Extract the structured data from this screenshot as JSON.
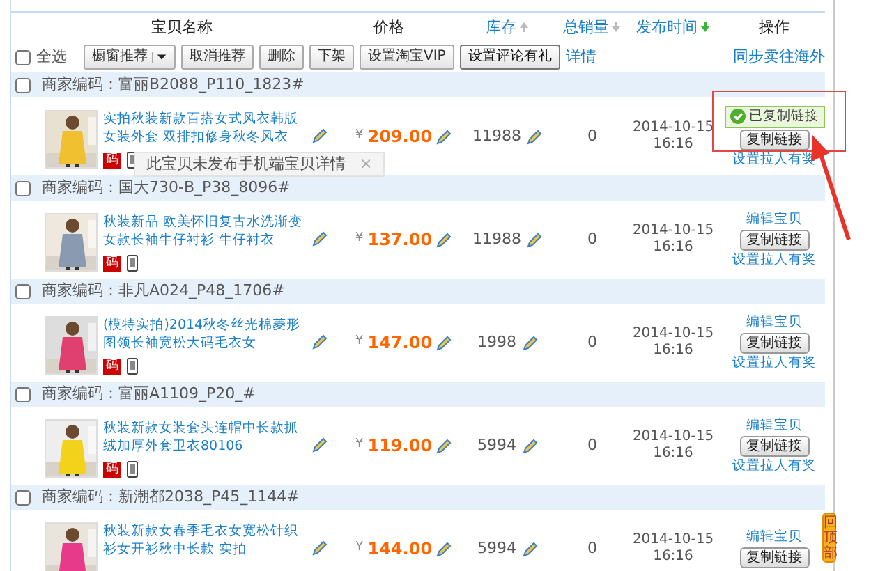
{
  "columns": [
    {
      "label": "宝贝名称",
      "kind": "plain"
    },
    {
      "label": "价格",
      "kind": "plain"
    },
    {
      "label": "库存",
      "kind": "sort",
      "ascending": true,
      "active": false
    },
    {
      "label": "总销量",
      "kind": "sort",
      "ascending": false,
      "active": false
    },
    {
      "label": "发布时间",
      "kind": "sort",
      "ascending": false,
      "active": true
    },
    {
      "label": "操作",
      "kind": "plain"
    }
  ],
  "toolbar": {
    "select_all": {
      "label": "全选",
      "checked": false
    },
    "buttons": [
      {
        "label": "橱窗推荐",
        "kind": "split"
      },
      {
        "label": "取消推荐",
        "kind": "button"
      },
      {
        "label": "删除",
        "kind": "button"
      },
      {
        "label": "下架",
        "kind": "button"
      },
      {
        "label": "设置淘宝VIP",
        "kind": "button"
      },
      {
        "label": "设置评论有礼",
        "kind": "strong"
      },
      {
        "label": "详情",
        "kind": "link"
      }
    ],
    "right_link": "同步卖往海外"
  },
  "groups": [
    {
      "code_label": "商家编码：",
      "code": "富丽B2088_P110_1823#",
      "checked": false,
      "highlighted": true,
      "tooltip": {
        "text": "此宝贝未发布手机端宝贝详情",
        "close": "×"
      },
      "item": {
        "title": "实拍秋装新款百搭女式风衣韩版女装外套 双排扣修身秋冬风衣",
        "badge": "码",
        "currency": "¥",
        "price": "209.00",
        "stock": "11988",
        "sales": "0",
        "date": "2014-10-15",
        "time": "16:16",
        "actions": [
          {
            "kind": "copied",
            "label": "已复制链接"
          },
          {
            "kind": "button",
            "label": "复制链接"
          },
          {
            "kind": "link",
            "label": "设置拉人有奖"
          }
        ]
      }
    },
    {
      "code_label": "商家编码：",
      "code": "国大730-B_P38_8096#",
      "checked": false,
      "highlighted": false,
      "item": {
        "title": "秋装新品 欧美怀旧复古水洗渐变女款长袖牛仔衬衫 牛仔衬衣",
        "badge": "码",
        "currency": "¥",
        "price": "137.00",
        "stock": "11988",
        "sales": "0",
        "date": "2014-10-15",
        "time": "16:16",
        "actions": [
          {
            "kind": "link",
            "label": "编辑宝贝"
          },
          {
            "kind": "button",
            "label": "复制链接"
          },
          {
            "kind": "link",
            "label": "设置拉人有奖"
          }
        ]
      }
    },
    {
      "code_label": "商家编码：",
      "code": "非凡A024_P48_1706#",
      "checked": false,
      "highlighted": false,
      "item": {
        "title": "(模特实拍)2014秋冬丝光棉菱形图领长袖宽松大码毛衣女",
        "badge": "码",
        "currency": "¥",
        "price": "147.00",
        "stock": "1998",
        "sales": "0",
        "date": "2014-10-15",
        "time": "16:16",
        "actions": [
          {
            "kind": "link",
            "label": "编辑宝贝"
          },
          {
            "kind": "button",
            "label": "复制链接"
          },
          {
            "kind": "link",
            "label": "设置拉人有奖"
          }
        ]
      }
    },
    {
      "code_label": "商家编码：",
      "code": "富丽A1109_P20_#",
      "checked": false,
      "highlighted": false,
      "item": {
        "title": "秋装新款女装套头连帽中长款抓绒加厚外套卫衣80106",
        "badge": "码",
        "currency": "¥",
        "price": "119.00",
        "stock": "5994",
        "sales": "0",
        "date": "2014-10-15",
        "time": "16:16",
        "actions": [
          {
            "kind": "link",
            "label": "编辑宝贝"
          },
          {
            "kind": "button",
            "label": "复制链接"
          },
          {
            "kind": "link",
            "label": "设置拉人有奖"
          }
        ]
      }
    },
    {
      "code_label": "商家编码：",
      "code": "新潮都2038_P45_1144#",
      "checked": false,
      "highlighted": false,
      "item": {
        "title": "秋装新款女春季毛衣女宽松针织衫女开衫秋中长款 实拍",
        "currency": "¥",
        "price": "144.00",
        "stock": "5994",
        "sales": "0",
        "date": "2014-10-15",
        "time": "16:16",
        "actions": [
          {
            "kind": "link",
            "label": "编辑宝贝"
          },
          {
            "kind": "button",
            "label": "复制链接"
          }
        ]
      }
    }
  ],
  "back_to_top": "回顶部"
}
